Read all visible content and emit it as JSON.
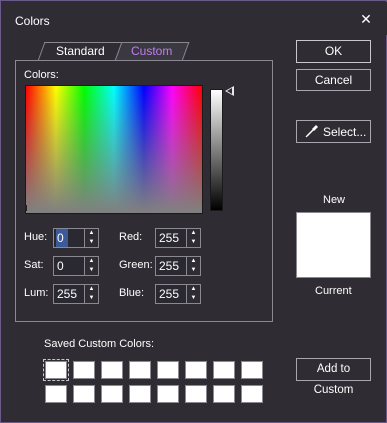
{
  "window": {
    "title": "Colors",
    "close_glyph": "✕"
  },
  "tabs": [
    {
      "label": "Standard",
      "active": false
    },
    {
      "label": "Custom",
      "active": true,
      "color": "#c27df0"
    }
  ],
  "custom": {
    "colors_label": "Colors:",
    "fields": {
      "hue": {
        "label": "Hue:",
        "value": "0"
      },
      "sat": {
        "label": "Sat:",
        "value": "0"
      },
      "lum": {
        "label": "Lum:",
        "value": "255"
      },
      "red": {
        "label": "Red:",
        "value": "255"
      },
      "green": {
        "label": "Green:",
        "value": "255"
      },
      "blue": {
        "label": "Blue:",
        "value": "255"
      }
    }
  },
  "buttons": {
    "ok": "OK",
    "cancel": "Cancel",
    "select": "Select...",
    "add_to_custom": "Add to Custom"
  },
  "preview": {
    "new_label": "New",
    "current_label": "Current",
    "new_color": "#ffffff"
  },
  "saved": {
    "label": "Saved Custom Colors:",
    "rows": 2,
    "cols": 8,
    "cell_color": "#ffffff"
  },
  "icons": {
    "close": "close-icon",
    "dropper": "eyedropper-icon",
    "spin_up": "chevron-up-icon",
    "spin_down": "chevron-down-icon",
    "lum_pointer": "triangle-pointer-icon"
  }
}
